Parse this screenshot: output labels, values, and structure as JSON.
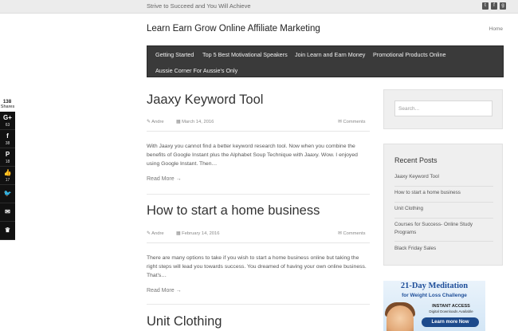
{
  "topbar": {
    "tagline": "Strive to Succeed and You Will Achieve",
    "social_icons": [
      "twitter-icon",
      "facebook-icon",
      "google-plus-icon"
    ]
  },
  "site": {
    "title": "Learn Earn Grow Online Affiliate Marketing",
    "home_link": "Home"
  },
  "nav": {
    "items": [
      "Getting Started",
      "Top 5 Best Motivational Speakers",
      "Join Learn and Earn Money",
      "Promotional Products Online",
      "Aussie Corner For Aussie's Only"
    ]
  },
  "share_bar": {
    "total": "138",
    "total_label": "Shares",
    "buttons": [
      {
        "icon": "google-plus-icon",
        "glyph": "G+",
        "count": "63"
      },
      {
        "icon": "facebook-icon",
        "glyph": "f",
        "count": "38"
      },
      {
        "icon": "pinterest-icon",
        "glyph": "P",
        "count": "18"
      },
      {
        "icon": "like-icon",
        "glyph": "👍",
        "count": "17"
      },
      {
        "icon": "twitter-icon",
        "glyph": "🐦",
        "count": ""
      },
      {
        "icon": "email-icon",
        "glyph": "✉",
        "count": ""
      },
      {
        "icon": "crown-icon",
        "glyph": "♛",
        "count": ""
      }
    ]
  },
  "posts": [
    {
      "title": "Jaaxy Keyword Tool",
      "author": "Andre",
      "date": "March 14, 2016",
      "comments": "Comments",
      "excerpt": "With Jaaxy you cannot find a better keyword research tool. Now when you combine the benefits of Google Instant plus the Alphabet Soup Technique with Jaaxy. Wow.    I enjoyed using Google Instant. Then…",
      "read_more": "Read More →"
    },
    {
      "title": "How to start a home business",
      "author": "Andre",
      "date": "February 14, 2016",
      "comments": "Comments",
      "excerpt": "There are many options to take if you wish to start a home business online but taking the right steps will lead you towards success.  You dreamed of having your own online business. That's…",
      "read_more": "Read More →"
    },
    {
      "title": "Unit Clothing"
    }
  ],
  "sidebar": {
    "search_placeholder": "Search...",
    "recent_title": "Recent Posts",
    "recent_posts": [
      "Jaaxy Keyword Tool",
      "How to start a home business",
      "Unit Clothing",
      "Courses for Success- Online Study Programs",
      "Black Friday Sales"
    ]
  },
  "ad": {
    "headline": "21-Day Meditation",
    "subheadline": "for Weight Loss Challenge",
    "instant": "INSTANT ACCESS",
    "digital": "Digital Downloads Available",
    "cta": "Learn more Now"
  },
  "colors": {
    "nav_bg": "#3a3a3a",
    "share_bg": "#111111",
    "sidebar_bg": "#efefef",
    "ad_blue": "#1f4f9a"
  }
}
